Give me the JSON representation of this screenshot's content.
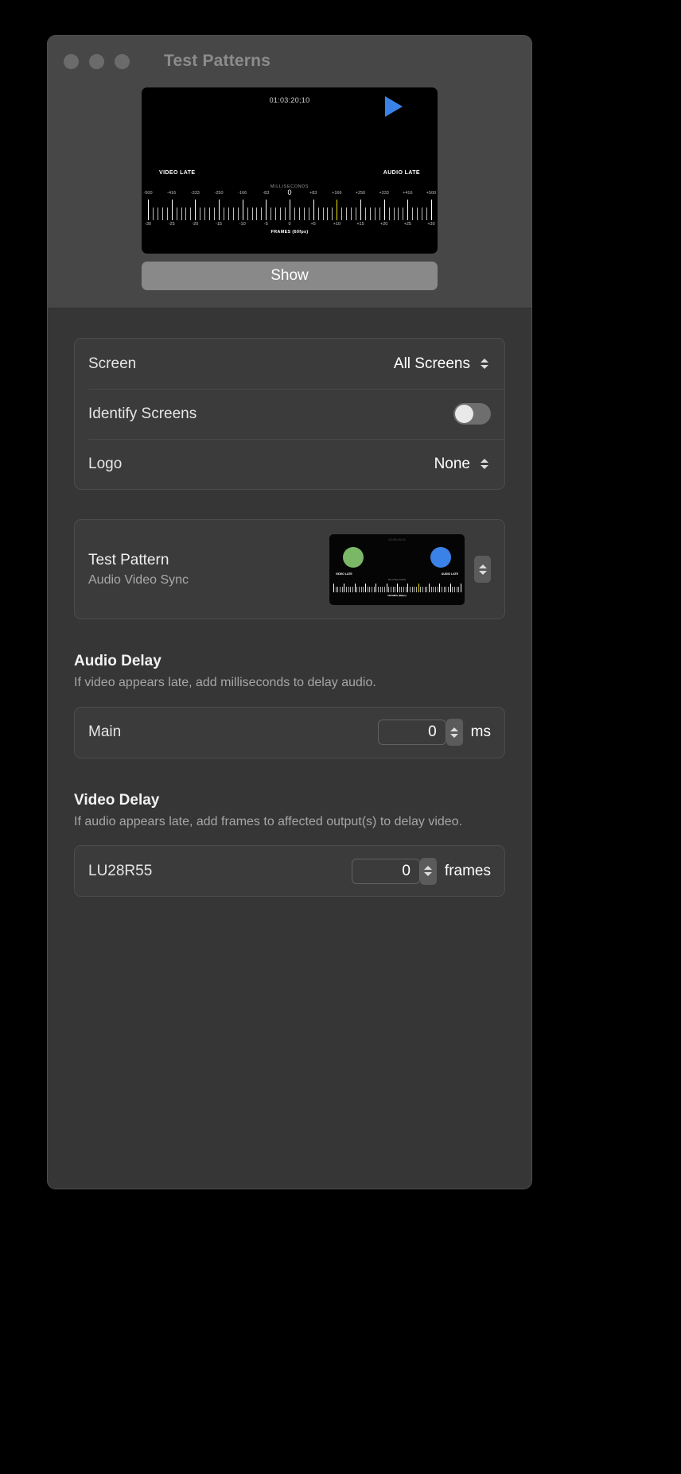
{
  "window": {
    "title": "Test Patterns",
    "traffic_lights": [
      "close-button",
      "minimize-button",
      "zoom-button"
    ]
  },
  "preview": {
    "timecode": "01:03:20;10",
    "video_late_label": "VIDEO LATE",
    "audio_late_label": "AUDIO LATE",
    "milliseconds_label": "MILLISECONDS",
    "ms_ticks": [
      "-500",
      "-416",
      "-333",
      "-250",
      "-166",
      "-83",
      "0",
      "+83",
      "+166",
      "+250",
      "+333",
      "+416",
      "+500"
    ],
    "frames_label": "FRAMES (60fps)",
    "frame_ticks": [
      "-30",
      "-25",
      "-20",
      "-15",
      "-10",
      "-5",
      "0",
      "+5",
      "+10",
      "+15",
      "+20",
      "+25",
      "+30"
    ],
    "play_icon": "play-triangle-icon",
    "marker_color": "#f2e600",
    "play_color": "#3b82e8"
  },
  "show_button": {
    "label": "Show"
  },
  "settings": {
    "screen": {
      "label": "Screen",
      "value": "All Screens"
    },
    "identify_screens": {
      "label": "Identify Screens",
      "state": "off"
    },
    "logo": {
      "label": "Logo",
      "value": "None"
    }
  },
  "test_pattern": {
    "label": "Test Pattern",
    "value": "Audio Video Sync",
    "thumbnail": {
      "timecode": "01:03:20;10",
      "video_late_label": "VIDEO LATE",
      "audio_late_label": "AUDIO LATE",
      "milliseconds_label": "MILLISECONDS",
      "frames_label": "FRAMES (60fps)",
      "green_color": "#7ab868",
      "blue_color": "#3b82e8"
    }
  },
  "audio_delay": {
    "heading": "Audio Delay",
    "description": "If video appears late, add milliseconds to delay audio.",
    "row": {
      "label": "Main",
      "value": "0",
      "unit": "ms"
    }
  },
  "video_delay": {
    "heading": "Video Delay",
    "description": "If audio appears late, add frames to affected output(s) to delay video.",
    "row": {
      "label": "LU28R55",
      "value": "0",
      "unit": "frames"
    }
  }
}
